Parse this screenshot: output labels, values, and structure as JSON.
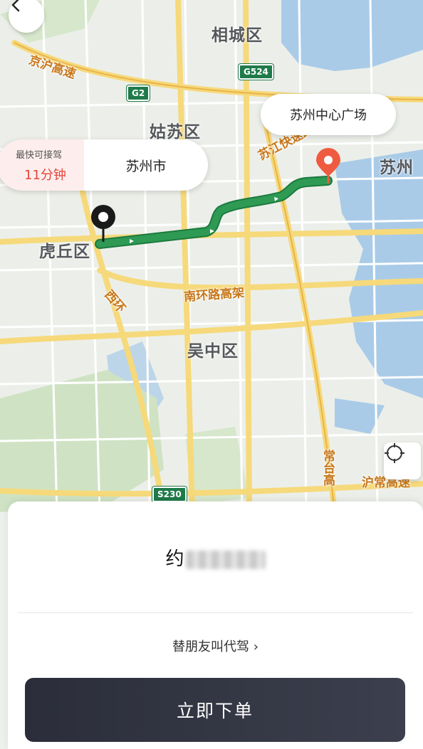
{
  "map": {
    "districts": [
      "相城区",
      "姑苏区",
      "虎丘区",
      "吴中区",
      "苏州"
    ],
    "roads": [
      "京沪高速",
      "苏江快速路",
      "南环路高架",
      "西环",
      "常台高",
      "沪常高速"
    ],
    "shields": [
      "G524",
      "G2",
      "S230"
    ],
    "destination_label": "苏州中心广场",
    "eta": {
      "title": "最快可接驾",
      "value": "11分钟"
    },
    "origin_city": "苏州市",
    "route_color": "#2e9a54",
    "origin_pin_color": "#1a1a1a",
    "destination_pin_color": "#ef5b40",
    "icons": {
      "back": "chevron-left-icon",
      "locate": "locate-target-icon"
    }
  },
  "panel": {
    "price_prefix": "约",
    "friend_link": "替朋友叫代驾 ›",
    "order_button": "立即下单",
    "button_color": "#2e303c"
  }
}
